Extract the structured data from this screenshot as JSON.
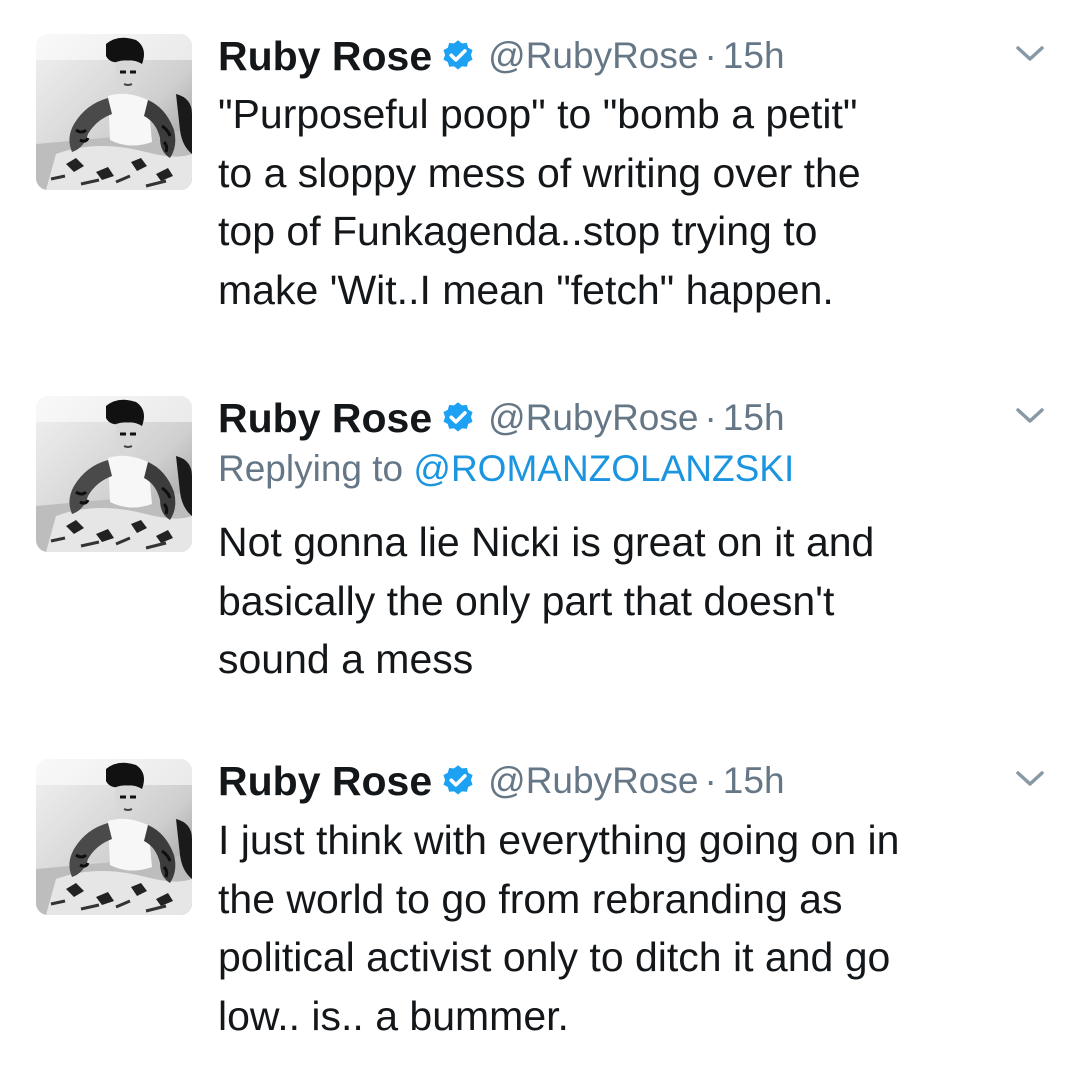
{
  "colors": {
    "text": "#14171a",
    "secondary": "#657786",
    "link": "#1b95e0",
    "verified": "#1da1f2"
  },
  "tweets": [
    {
      "name": "Ruby Rose",
      "handle": "@RubyRose",
      "separator": "·",
      "time": "15h",
      "verified_icon": "verified-badge-icon",
      "menu_icon": "chevron-down-icon",
      "text": "\"Purposeful poop\" to \"bomb a petit\"\nto a sloppy mess of writing over the\ntop of Funkagenda..stop trying to\nmake 'Wit..I mean \"fetch\" happen."
    },
    {
      "name": "Ruby Rose",
      "handle": "@RubyRose",
      "separator": "·",
      "time": "15h",
      "verified_icon": "verified-badge-icon",
      "menu_icon": "chevron-down-icon",
      "reply_prefix": "Replying to",
      "reply_to": "@ROMANZOLANZSKI",
      "text": "Not gonna lie Nicki is great on it and\nbasically the only part that doesn't\nsound a mess"
    },
    {
      "name": "Ruby Rose",
      "handle": "@RubyRose",
      "separator": "·",
      "time": "15h",
      "verified_icon": "verified-badge-icon",
      "menu_icon": "chevron-down-icon",
      "text": "I just think with everything going on in\nthe world to go from rebranding as\npolitical activist only to ditch it and go\nlow.. is.. a bummer."
    }
  ]
}
